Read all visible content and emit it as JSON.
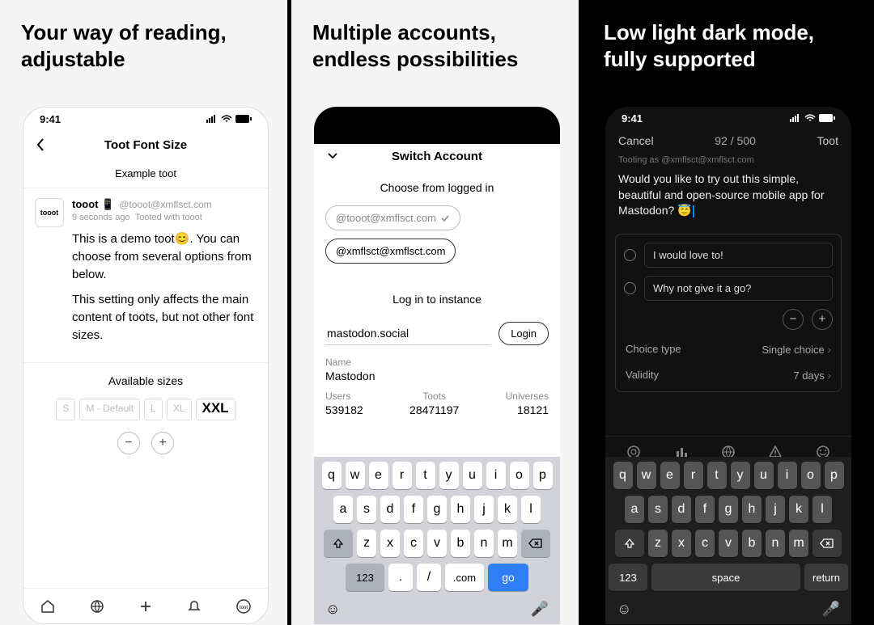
{
  "panels": {
    "one": {
      "title": "Your way of reading, adjustable",
      "status_time": "9:41",
      "nav_title": "Toot Font Size",
      "example_label": "Example toot",
      "toot": {
        "avatar_text": "tooot",
        "username": "tooot 📱",
        "handle": "@tooot@xmflsct.com",
        "time_ago": "9 seconds ago",
        "client": "Tooted with tooot",
        "para1": "This is a demo toot😊. You can choose from several options from below.",
        "para2": "This setting only affects the main content of toots, but not other font sizes."
      },
      "sizes_label": "Available sizes",
      "sizes": {
        "s": "S",
        "m": "M - Default",
        "l": "L",
        "xl": "XL",
        "xxl": "XXL"
      }
    },
    "two": {
      "title": "Multiple accounts, endless possibilities",
      "sheet_title": "Switch Account",
      "choose_label": "Choose from logged in",
      "accounts": {
        "a1": "@tooot@xmflsct.com",
        "a2": "@xmflsct@xmflsct.com"
      },
      "login_label": "Log in to instance",
      "instance_value": "mastodon.social",
      "login_btn": "Login",
      "name_label": "Name",
      "name_value": "Mastodon",
      "stats": {
        "users_label": "Users",
        "users_value": "539182",
        "toots_label": "Toots",
        "toots_value": "28471197",
        "universes_label": "Universes",
        "universes_value": "18121"
      },
      "kb": {
        "row1": [
          "q",
          "w",
          "e",
          "r",
          "t",
          "y",
          "u",
          "i",
          "o",
          "p"
        ],
        "row2": [
          "a",
          "s",
          "d",
          "f",
          "g",
          "h",
          "j",
          "k",
          "l"
        ],
        "row3": [
          "z",
          "x",
          "c",
          "v",
          "b",
          "n",
          "m"
        ],
        "num": "123",
        "dot": ".",
        "slash": "/",
        "com": ".com",
        "go": "go"
      }
    },
    "three": {
      "title": "Low light dark mode, fully supported",
      "status_time": "9:41",
      "cancel": "Cancel",
      "counter": "92 / 500",
      "toot_btn": "Toot",
      "tooting_as": "Tooting as @xmflsct@xmflsct.com",
      "compose_text": "Would you like to try out this simple, beautiful and open-source mobile app for Mastodon? 😇",
      "poll": {
        "opt1": "I would love to!",
        "opt2": "Why not give it a go?",
        "choice_type_label": "Choice type",
        "choice_type_value": "Single choice",
        "validity_label": "Validity",
        "validity_value": "7 days"
      },
      "kb": {
        "row1": [
          "q",
          "w",
          "e",
          "r",
          "t",
          "y",
          "u",
          "i",
          "o",
          "p"
        ],
        "row2": [
          "a",
          "s",
          "d",
          "f",
          "g",
          "h",
          "j",
          "k",
          "l"
        ],
        "row3": [
          "z",
          "x",
          "c",
          "v",
          "b",
          "n",
          "m"
        ],
        "num": "123",
        "space": "space",
        "return": "return"
      }
    }
  }
}
